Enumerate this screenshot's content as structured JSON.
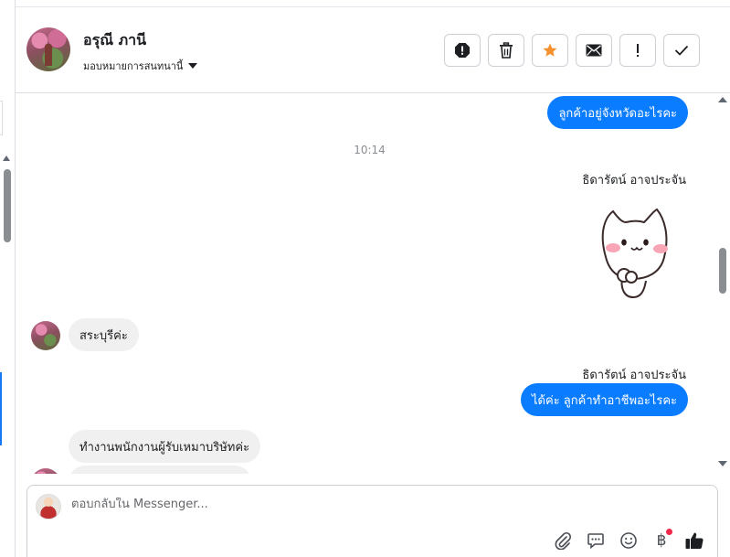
{
  "header": {
    "contact_name": "อรุณี ภานี",
    "assign_label": "มอบหมายการสนทนานี้",
    "actions": [
      {
        "name": "spam-button",
        "icon": "octagon-alert-icon"
      },
      {
        "name": "delete-button",
        "icon": "trash-icon"
      },
      {
        "name": "star-button",
        "icon": "star-icon"
      },
      {
        "name": "mark-unread-button",
        "icon": "envelope-icon"
      },
      {
        "name": "follow-up-button",
        "icon": "exclamation-icon"
      },
      {
        "name": "mark-done-button",
        "icon": "check-icon"
      }
    ]
  },
  "messages": {
    "m1": "ลูกค้าอยู่จังหวัดอะไรคะ",
    "time": "10:14",
    "sender1": "ธิดารัตน์ อาจประจัน",
    "m3": "สระบุรีค่ะ",
    "sender2": "ธิดารัตน์ อาจประจัน",
    "m4": "ได้ค่ะ ลูกค้าทำอาชีพอะไรคะ",
    "m5": "ทำงานพนักงานผู้รับเหมาบริษัทค่ะ"
  },
  "composer": {
    "placeholder": "ตอบกลับใน Messenger...",
    "baht_symbol": "฿"
  },
  "colors": {
    "outgoing_bubble": "#0a7cff",
    "incoming_bubble": "#f0f0f0",
    "star": "#f5922f"
  }
}
